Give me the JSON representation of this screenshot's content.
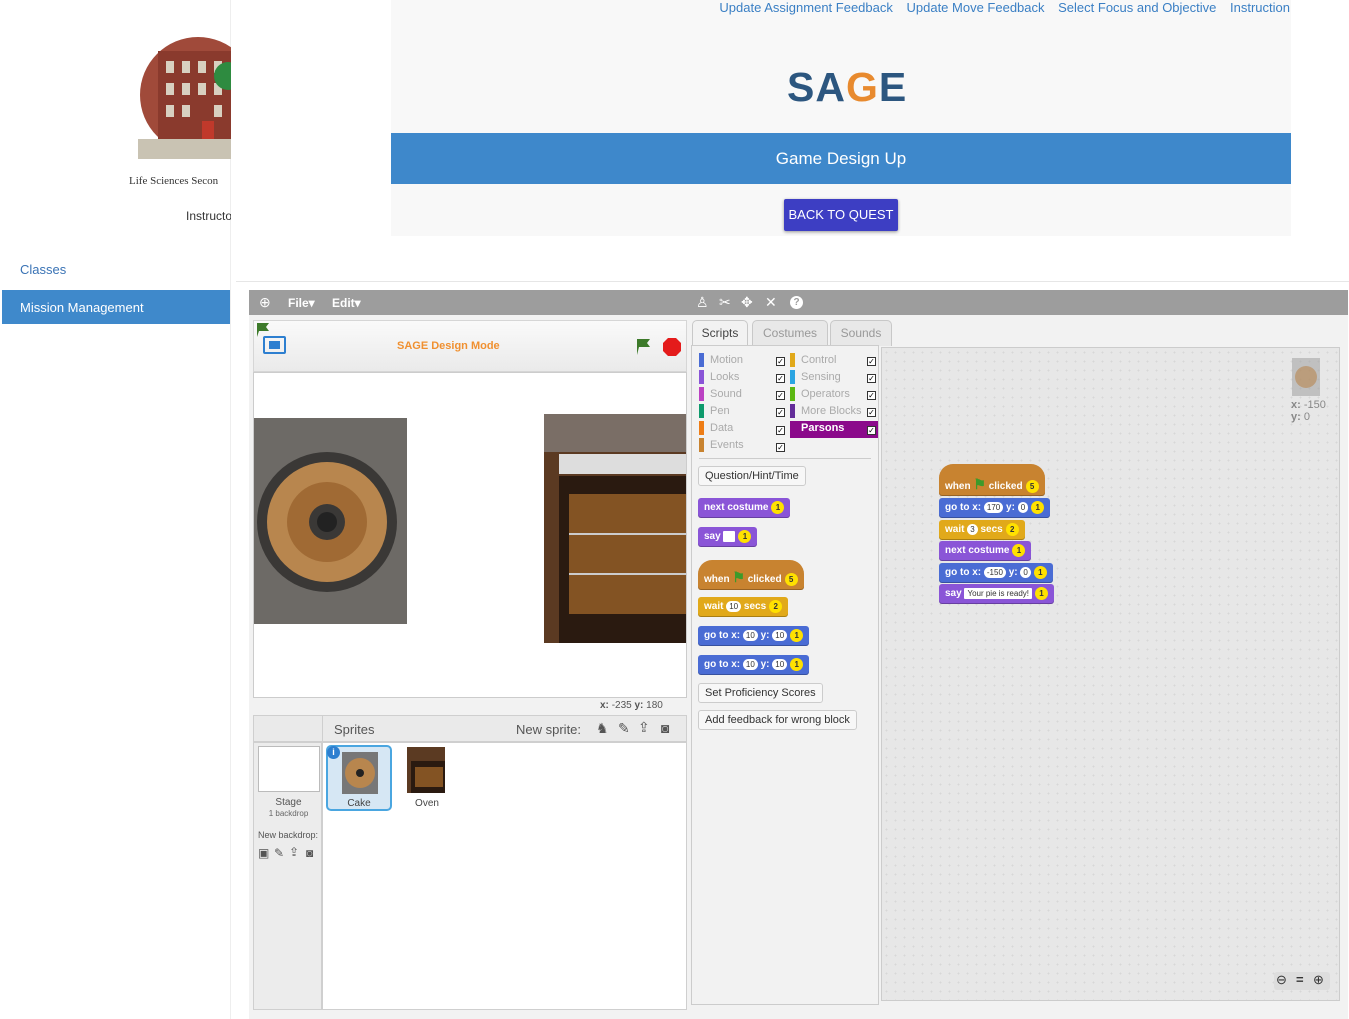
{
  "school": {
    "name": "Life Sciences Secon",
    "role": "Instructo"
  },
  "sidebar": {
    "items": [
      {
        "label": "Classes"
      },
      {
        "label": "Mission Management"
      }
    ]
  },
  "toplinks": [
    "Update Assignment Feedback",
    "Update Move Feedback",
    "Select Focus and Objective",
    "Instruction"
  ],
  "logo": {
    "part1": "SA",
    "part2": "G",
    "part3": "E"
  },
  "banner": {
    "title": "Game Design Up"
  },
  "back_button": "BACK TO QUEST",
  "menu": {
    "file": "File",
    "edit": "Edit"
  },
  "stage": {
    "mode_label": "SAGE Design Mode",
    "coords_x": "-235",
    "coords_y": "180"
  },
  "sprites_panel": {
    "title": "Sprites",
    "new_sprite": "New sprite:",
    "stage_label": "Stage",
    "backdrop_count": "1 backdrop",
    "new_backdrop": "New backdrop:",
    "sprites": [
      "Cake",
      "Oven"
    ]
  },
  "tabs": [
    "Scripts",
    "Costumes",
    "Sounds"
  ],
  "categories_left": [
    "Motion",
    "Looks",
    "Sound",
    "Pen",
    "Data",
    "Events"
  ],
  "categories_right": [
    "Control",
    "Sensing",
    "Operators",
    "More Blocks",
    "Parsons"
  ],
  "category_colors": {
    "Motion": "#4a6cd4",
    "Looks": "#8a55d7",
    "Sound": "#bb42c3",
    "Pen": "#0e9a6c",
    "Data": "#ee7d16",
    "Events": "#c88330",
    "Control": "#e1a91a",
    "Sensing": "#2ca5e2",
    "Operators": "#5cb712",
    "More Blocks": "#632d99",
    "Parsons": "#8b0a8b"
  },
  "palette": {
    "question_btn": "Question/Hint/Time",
    "prof_btn": "Set Proficiency Scores",
    "feedback_btn": "Add feedback for wrong block",
    "blocks": {
      "next_costume": "next costume",
      "say": "say",
      "when": "when",
      "clicked": "clicked",
      "wait": "wait",
      "secs": "secs",
      "goto": "go to x:",
      "y": "y:",
      "star1": "1",
      "star2": "2",
      "star5": "5",
      "val10": "10"
    }
  },
  "script": {
    "goto1_x": "170",
    "goto1_y": "0",
    "wait_val": "3",
    "goto2_x": "-150",
    "goto2_y": "0",
    "say_text": "Your pie is ready!"
  },
  "sprite_info": {
    "x_label": "x:",
    "x": "-150",
    "y_label": "y:",
    "y": "0"
  },
  "icons": [
    "globe-icon",
    "stamp-icon",
    "cut-icon",
    "grow-icon",
    "shrink-icon",
    "help-icon",
    "flag-icon",
    "stop-icon",
    "zoom-in-icon",
    "zoom-out-icon",
    "zoom-reset-icon",
    "paint-icon",
    "upload-icon",
    "camera-icon"
  ]
}
